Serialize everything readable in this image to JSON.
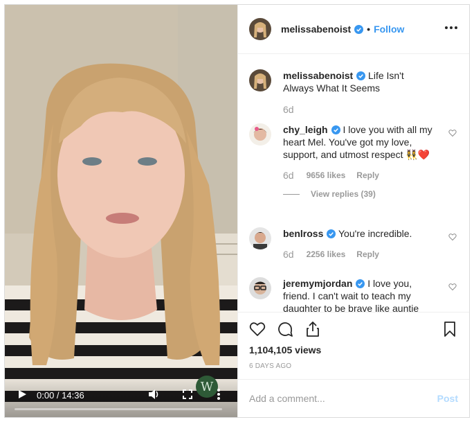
{
  "video": {
    "time_display": "0:00 / 14:36",
    "progress": 0,
    "watermark_letter": "W",
    "icons": [
      "play-icon",
      "volume-icon",
      "fullscreen-icon",
      "more-vertical-icon"
    ]
  },
  "header": {
    "username": "melissabenoist",
    "verified": true,
    "separator": "•",
    "follow_label": "Follow",
    "more_icon": "ellipsis-icon"
  },
  "caption": {
    "username": "melissabenoist",
    "text": "Life Isn't Always What It Seems",
    "age": "6d"
  },
  "comments": [
    {
      "username": "chy_leigh",
      "text": "I love you with all my heart Mel. You've got my love, support, and utmost respect 👯‍♀️❤️",
      "age": "6d",
      "likes": "9656 likes",
      "reply_label": "Reply",
      "view_replies": "View replies (39)"
    },
    {
      "username": "benlross",
      "text": "You're incredible.",
      "age": "6d",
      "likes": "2256 likes",
      "reply_label": "Reply"
    },
    {
      "username": "jeremymjordan",
      "text": "I love you, friend. I can't wait to teach my daughter to be brave like auntie"
    }
  ],
  "actions": {
    "icons": [
      "heart-icon",
      "comment-icon",
      "share-icon",
      "bookmark-icon"
    ],
    "views": "1,104,105 views",
    "posted": "6 DAYS AGO"
  },
  "add_comment": {
    "placeholder": "Add a comment...",
    "post_label": "Post"
  },
  "colors": {
    "accent": "#3897f0",
    "verified": "#3897f0",
    "muted": "#999999",
    "post_disabled": "#b3dbff"
  }
}
